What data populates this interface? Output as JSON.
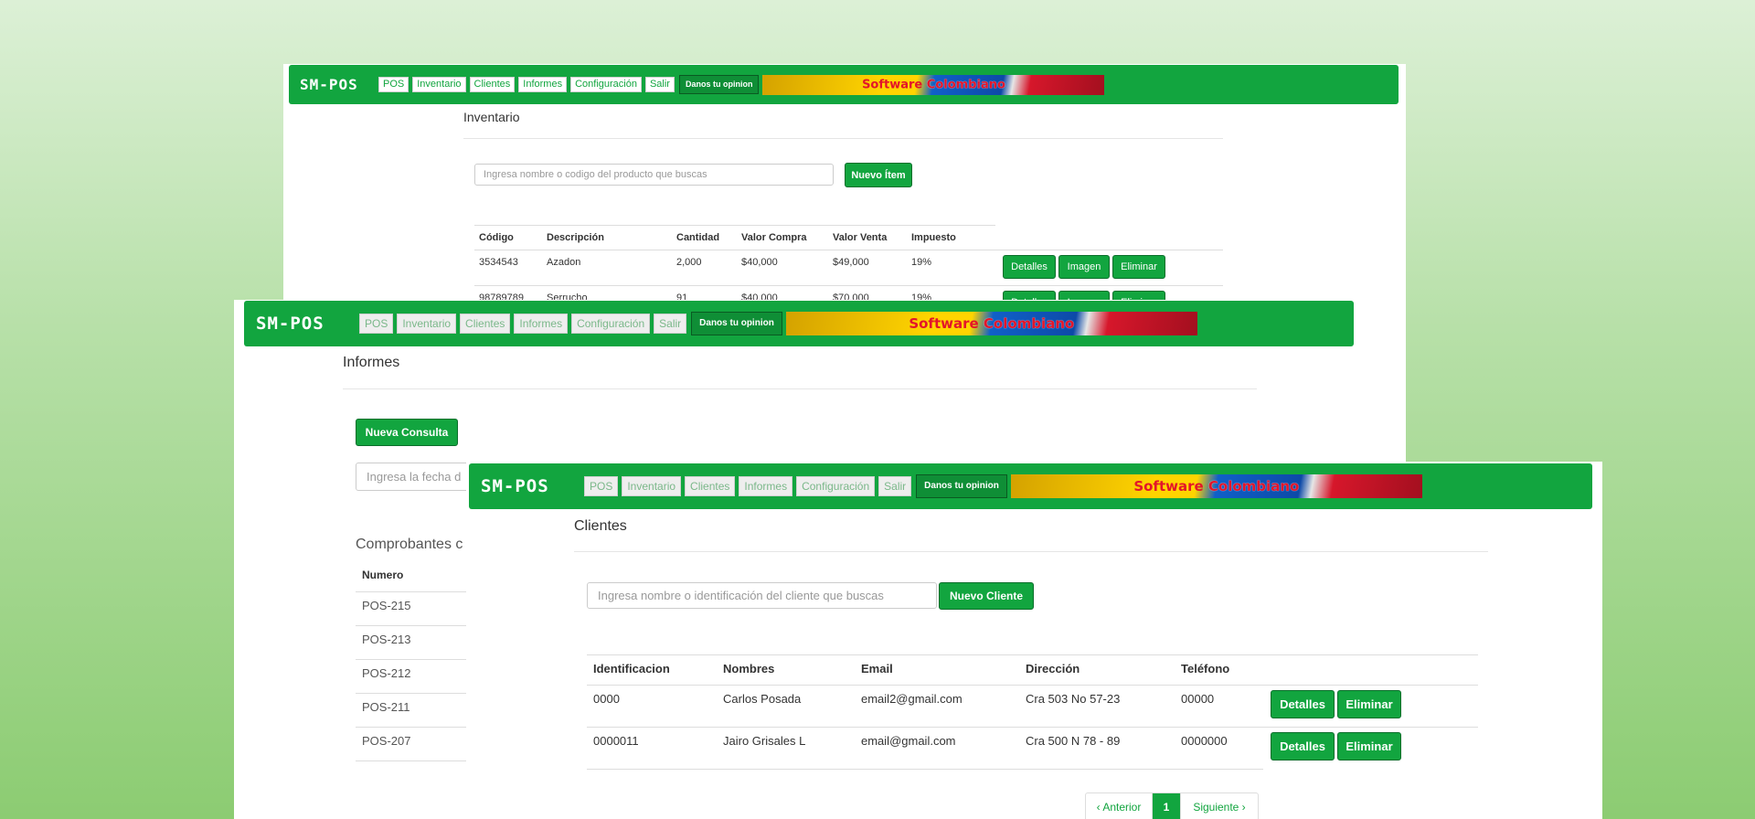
{
  "nav": {
    "logo": "SM-POS",
    "links": [
      "POS",
      "Inventario",
      "Clientes",
      "Informes",
      "Configuración",
      "Salir"
    ],
    "opinion": "Danos tu opinion",
    "banner_word1": "Software",
    "banner_word2": "Colombiano"
  },
  "inventario": {
    "title": "Inventario",
    "search_placeholder": "Ingresa nombre o codigo del producto que buscas",
    "new_button": "Nuevo Ítem",
    "headers": [
      "Código",
      "Descripción",
      "Cantidad",
      "Valor Compra",
      "Valor Venta",
      "Impuesto"
    ],
    "rows": [
      {
        "codigo": "3534543",
        "descripcion": "Azadon",
        "cantidad": "2,000",
        "compra": "$40,000",
        "venta": "$49,000",
        "impuesto": "19%"
      },
      {
        "codigo": "98789789",
        "descripcion": "Serrucho",
        "cantidad": "91",
        "compra": "$40,000",
        "venta": "$70,000",
        "impuesto": "19%"
      }
    ],
    "actions": [
      "Detalles",
      "Imagen",
      "Eliminar"
    ]
  },
  "informes": {
    "title": "Informes",
    "new_button": "Nueva Consulta",
    "date_placeholder": "Ingresa la fecha d",
    "section_title": "Comprobantes c",
    "column_header": "Numero",
    "numbers": [
      "POS-215",
      "POS-213",
      "POS-212",
      "POS-211",
      "POS-207"
    ]
  },
  "clientes": {
    "title": "Clientes",
    "search_placeholder": "Ingresa nombre o identificación del cliente que buscas",
    "new_button": "Nuevo Cliente",
    "headers": [
      "Identificacion",
      "Nombres",
      "Email",
      "Dirección",
      "Teléfono"
    ],
    "rows": [
      {
        "id": "0000",
        "nombre": "Carlos Posada",
        "email": "email2@gmail.com",
        "direccion": "Cra 503 No 57-23",
        "telefono": "00000"
      },
      {
        "id": "0000011",
        "nombre": "Jairo Grisales L",
        "email": "email@gmail.com",
        "direccion": "Cra 500 N 78 - 89",
        "telefono": "0000000"
      }
    ],
    "actions": [
      "Detalles",
      "Eliminar"
    ],
    "pager": {
      "prev": "‹ Anterior",
      "page": "1",
      "next": "Siguiente ›"
    }
  },
  "colors": {
    "brand_green": "#12a53f",
    "background": "#b7e0a8"
  }
}
